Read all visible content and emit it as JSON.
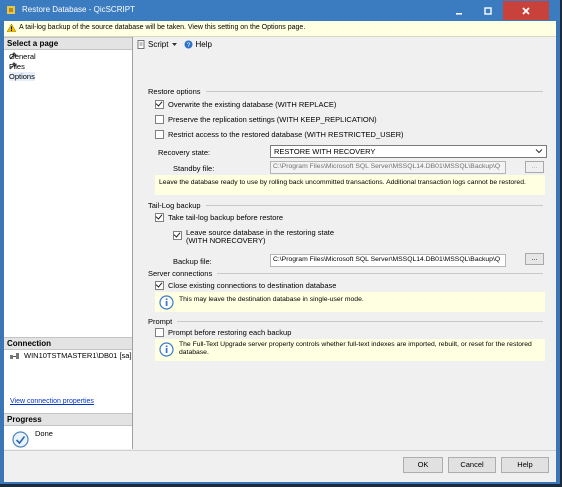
{
  "window": {
    "title": "Restore Database - QicSCRIPT"
  },
  "infobar": {
    "text": "A tail-log backup of the source database will be taken. View this setting on the Options page."
  },
  "left": {
    "select_page_header": "Select a page",
    "pages": [
      {
        "label": "General"
      },
      {
        "label": "Files"
      },
      {
        "label": "Options"
      }
    ],
    "connection_header": "Connection",
    "connection_value": "WIN10TSTMASTER1\\DB01 [sa]",
    "view_connection_link": "View connection properties",
    "progress_header": "Progress",
    "progress_status": "Done"
  },
  "toolbar": {
    "script_label": "Script",
    "help_label": "Help"
  },
  "restore_options": {
    "header": "Restore options",
    "overwrite": "Overwrite the existing database (WITH REPLACE)",
    "preserve": "Preserve the replication settings (WITH KEEP_REPLICATION)",
    "restrict": "Restrict access to the restored database (WITH RESTRICTED_USER)",
    "recovery_label": "Recovery state:",
    "recovery_value": "RESTORE WITH RECOVERY",
    "standby_label": "Standby file:",
    "standby_value": "C:\\Program Files\\Microsoft SQL Server\\MSSQL14.DB01\\MSSQL\\Backup\\Q",
    "recovery_note": "Leave the database ready to use by rolling back uncommitted transactions. Additional transaction logs cannot be restored."
  },
  "tail_log": {
    "header": "Tail-Log backup",
    "take_backup": "Take tail-log backup before restore",
    "leave_source_line1": "Leave source database in the restoring state",
    "leave_source_line2": "(WITH NORECOVERY)",
    "backup_file_label": "Backup file:",
    "backup_file_value": "C:\\Program Files\\Microsoft SQL Server\\MSSQL14.DB01\\MSSQL\\Backup\\Q"
  },
  "server_connections": {
    "header": "Server connections",
    "close_existing": "Close existing connections to destination database",
    "note": "This may leave the destination database in single-user mode."
  },
  "prompt": {
    "header": "Prompt",
    "prompt_before": "Prompt before restoring each backup",
    "note": "The Full-Text Upgrade server property controls whether full-text indexes are imported, rebuilt, or reset for the restored database."
  },
  "buttons": {
    "ok": "OK",
    "cancel": "Cancel",
    "help": "Help"
  },
  "ellipsis": "..."
}
